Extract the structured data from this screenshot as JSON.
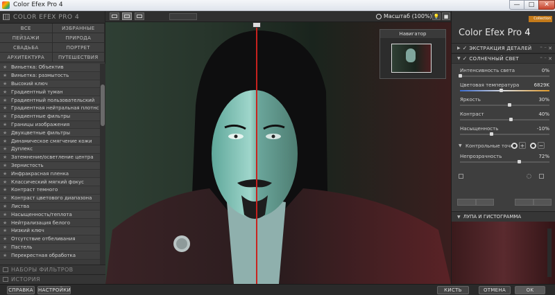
{
  "window": {
    "title": "Color Efex Pro 4",
    "min": "—",
    "max": "□",
    "close": "✕"
  },
  "left": {
    "brand": "COLOR EFEX PRO 4",
    "categories": [
      "ВСЕ",
      "ИЗБРАННЫЕ",
      "ПЕЙЗАЖИ",
      "ПРИРОДА",
      "СВАДЬБА",
      "ПОРТРЕТ",
      "АРХИТЕКТУРА",
      "ПУТЕШЕСТВИЯ"
    ],
    "filters": [
      "Виньетка: Объектив",
      "Виньетка: размытость",
      "Высокий ключ",
      "Градиентный туман",
      "Градиентный пользовательский",
      "Градиентная нейтральная плотнс",
      "Градиентные фильтры",
      "Границы изображения",
      "Двухцветные фильтры",
      "Динамическое смягчение кожи",
      "Дуплекс",
      "Затемнение/осветление центра",
      "Зернистость",
      "Инфракрасная пленка",
      "Классический мягкий фокус",
      "Контраст темного",
      "Контраст цветового диапазона",
      "Листва",
      "Насыщенность/теплота",
      "Нейтрализация белого",
      "Низкий ключ",
      "Отсутствие отбеливания",
      "Пастель",
      "Перекрестная обработка"
    ],
    "star": "★",
    "sets_label": "НАБОРЫ ФИЛЬТРОВ",
    "history_label": "ИСТОРИЯ"
  },
  "toolbar": {
    "zoom_label": "Масштаб (100%)",
    "zoom_chevron": "▾"
  },
  "navigator": {
    "title": "Навигатор"
  },
  "right": {
    "logo": "Collection",
    "title": "Color Efex Pro",
    "title_num": "4",
    "filter1": {
      "name": "ЭКСТРАКЦИЯ ДЕТАЛЕЙ",
      "ctl": "⁼ ⁻ ✕"
    },
    "filter2": {
      "name": "СОЛНЕЧНЫЙ СВЕТ",
      "ctl": "⁼ ⁻ ✕"
    },
    "params": [
      {
        "label": "Интенсивность света",
        "value": "0%",
        "pos": 0.0
      },
      {
        "label": "Цветовая температура",
        "value": "6829K",
        "pos": 0.5
      },
      {
        "label": "Яркость",
        "value": "30%",
        "pos": 0.6
      },
      {
        "label": "Контраст",
        "value": "40%",
        "pos": 0.62
      },
      {
        "label": "Насыщенность",
        "value": "-10%",
        "pos": 0.38
      }
    ],
    "control_points": "Контрольные точки",
    "opacity": {
      "label": "Непрозрачность",
      "value": "72%",
      "pos": 0.72
    },
    "loupe": "ЛУПА И ГИСТОГРАММА",
    "plus": "+",
    "minus": "−"
  },
  "bottom": {
    "help": "СПРАВКА",
    "settings": "НАСТРОЙКИ",
    "brush": "КИСТЬ",
    "cancel": "ОТМЕНА",
    "ok": "OK"
  }
}
